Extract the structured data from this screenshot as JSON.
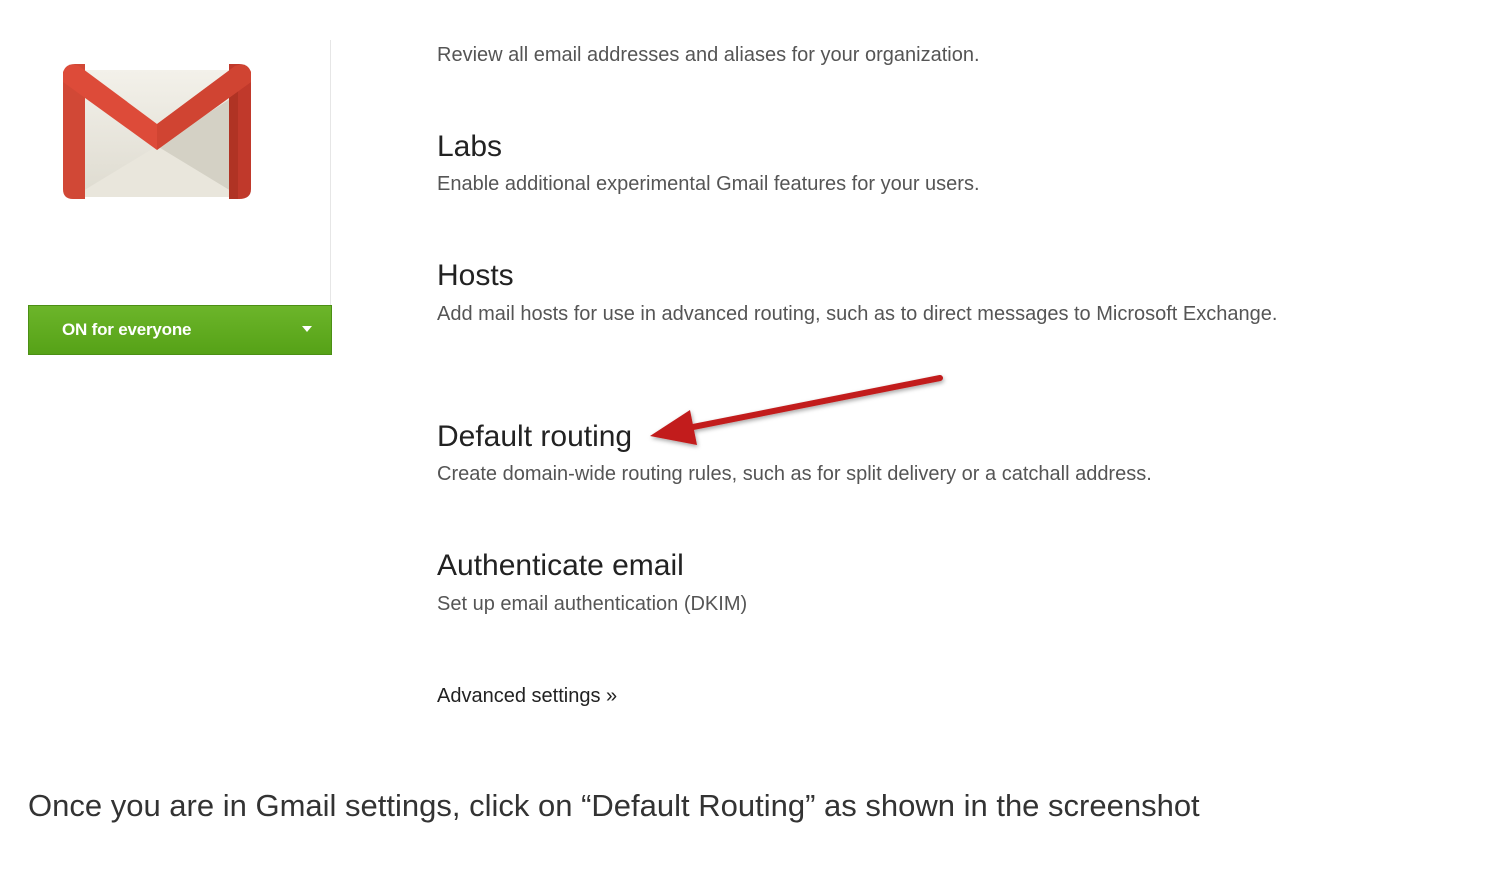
{
  "status_button": {
    "label": "ON for everyone"
  },
  "settings": [
    {
      "title": "",
      "description": "Review all email addresses and aliases for your organization."
    },
    {
      "title": "Labs",
      "description": "Enable additional experimental Gmail features for your users."
    },
    {
      "title": "Hosts",
      "description": "Add mail hosts for use in advanced routing, such as to direct messages to Microsoft Exchange."
    },
    {
      "title": "Default routing",
      "description": "Create domain-wide routing rules, such as for split delivery or a catchall address."
    },
    {
      "title": "Authenticate email",
      "description": "Set up email authentication (DKIM)"
    }
  ],
  "advanced_link": "Advanced settings »",
  "caption": "Once you are in Gmail settings, click on “Default Routing” as shown in the screenshot",
  "icons": {
    "logo": "gmail-logo",
    "status_caret": "caret-down-icon",
    "annotation": "red-arrow"
  },
  "colors": {
    "status_green": "#5aa51d",
    "arrow_red": "#c21b1b",
    "gmail_red": "#d14836"
  }
}
